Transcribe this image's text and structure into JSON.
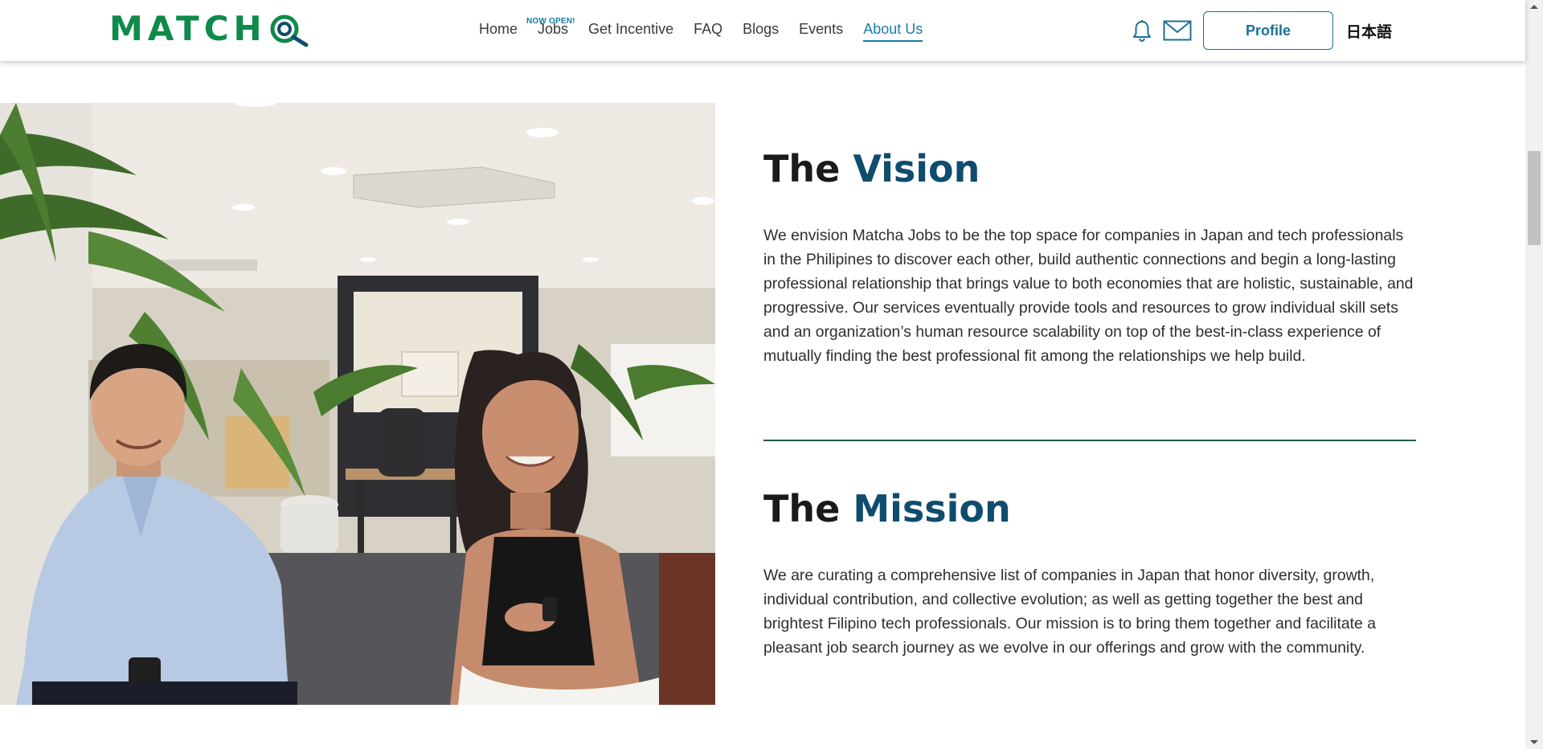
{
  "header": {
    "logo_text": "MATCH",
    "nav": [
      {
        "label": "Home"
      },
      {
        "label": "Jobs",
        "badge": "NOW OPEN!"
      },
      {
        "label": "Get Incentive"
      },
      {
        "label": "FAQ"
      },
      {
        "label": "Blogs"
      },
      {
        "label": "Events"
      },
      {
        "label": "About Us",
        "active": true
      }
    ],
    "profile_label": "Profile",
    "language_label": "日本語",
    "icons": [
      "bell-icon",
      "mail-icon"
    ]
  },
  "vision": {
    "title_prefix": "The",
    "title_accent": "Vision",
    "body": "We envision Matcha Jobs to be the top space for companies in Japan and tech professionals in the Philipines to discover each other, build authentic connections and begin a long-lasting professional relationship that brings value to both economies that are holistic, sustainable, and progressive. Our services eventually provide tools and resources to grow individual skill sets and an organization’s human resource scalability on top of the best-in-class experience of mutually finding the best professional fit among the relationships we help build."
  },
  "mission": {
    "title_prefix": "The",
    "title_accent": "Mission",
    "body": "We are curating a comprehensive list of companies in Japan that honor diversity, growth, individual contribution, and collective evolution; as well as getting together the best and brightest Filipino tech professionals. Our mission is to bring them together and facilitate a pleasant job search journey as we evolve in our offerings and grow with the community."
  },
  "colors": {
    "brand_green": "#0e8a4a",
    "accent_blue": "#1b7aa8",
    "title_accent": "#0f4c6e",
    "divider": "#145c47"
  }
}
